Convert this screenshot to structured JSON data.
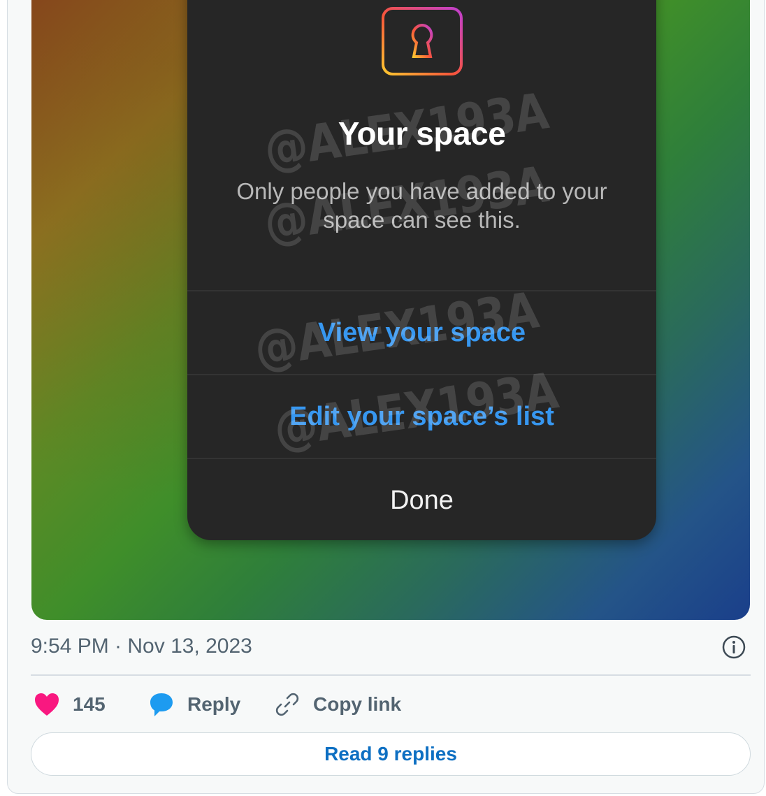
{
  "sheet": {
    "title": "Your space",
    "description": "Only people you have added to your space can see this.",
    "buttons": {
      "view": "View your space",
      "edit": "Edit your space’s list",
      "done": "Done"
    }
  },
  "watermark": "@ALEX193A",
  "tweet": {
    "timestamp": "9:54 PM · Nov 13, 2023",
    "likes": "145",
    "reply_label": "Reply",
    "copy_label": "Copy link",
    "read_replies": "Read 9 replies"
  },
  "colors": {
    "sheet_bg": "#262626",
    "action_blue": "#3797f0",
    "like_pink": "#f91880",
    "reply_blue": "#1d9bf0",
    "link_blue": "#0d6fc2"
  },
  "icons": [
    "lock-icon",
    "info-icon",
    "heart-icon",
    "reply-bubble-icon",
    "link-icon"
  ]
}
